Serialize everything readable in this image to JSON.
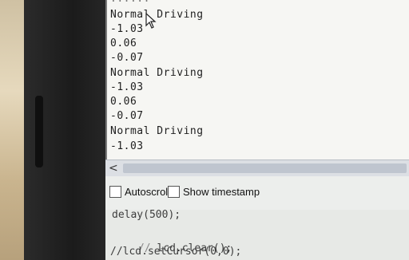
{
  "serial": {
    "top_partial": "......",
    "lines": [
      "Normal Driving",
      "-1.03",
      "0.06",
      "-0.07",
      "Normal Driving",
      "-1.03",
      "0.06",
      "-0.07",
      "Normal Driving",
      "-1.03"
    ]
  },
  "scroll": {
    "left_arrow": "<"
  },
  "options": {
    "autoscroll_label": "Autoscroll",
    "timestamp_label": "Show timestamp"
  },
  "code": {
    "line1": "delay(500);",
    "line2_prefix": "//",
    "line2_text": " lcd.clear();",
    "line3": "//lcd.setCursor(0,0);"
  }
}
